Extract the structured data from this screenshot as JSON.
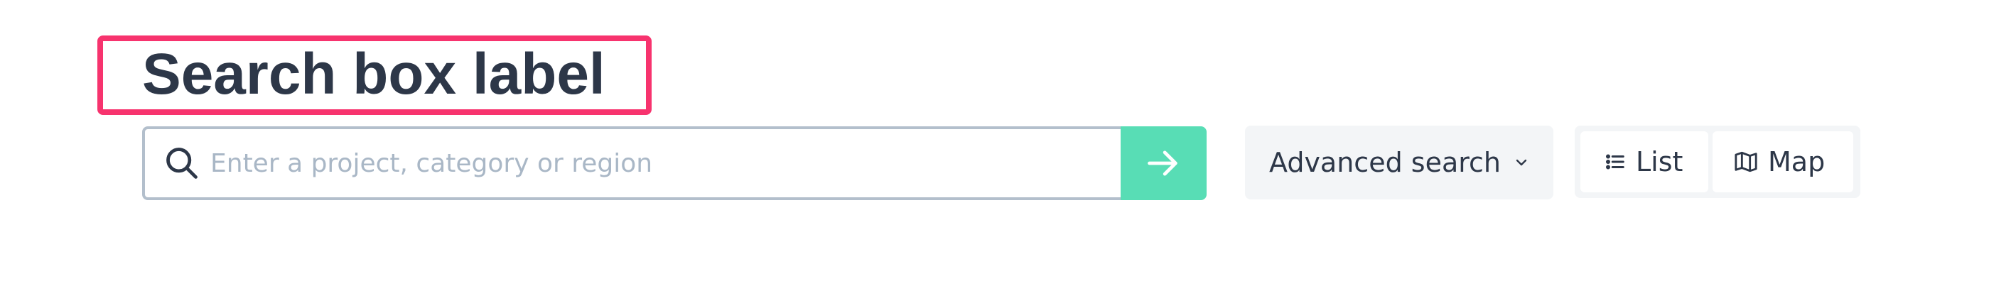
{
  "title": "Search box label",
  "search": {
    "placeholder": "Enter a project, category or region",
    "value": "",
    "search_icon": "search-icon",
    "submit_icon": "arrow-right-icon"
  },
  "advanced_search": {
    "label": "Advanced search",
    "icon": "chevron-down-icon"
  },
  "view_toggle": {
    "list_label": "List",
    "list_icon": "list-icon",
    "map_label": "Map",
    "map_icon": "map-icon"
  },
  "colors": {
    "text": "#2d3748",
    "placeholder": "#a9b7c6",
    "submit_bg": "#58ddb5",
    "control_bg": "#f3f5f7",
    "border": "#b3bfcc",
    "annotation": "#f7336e"
  }
}
